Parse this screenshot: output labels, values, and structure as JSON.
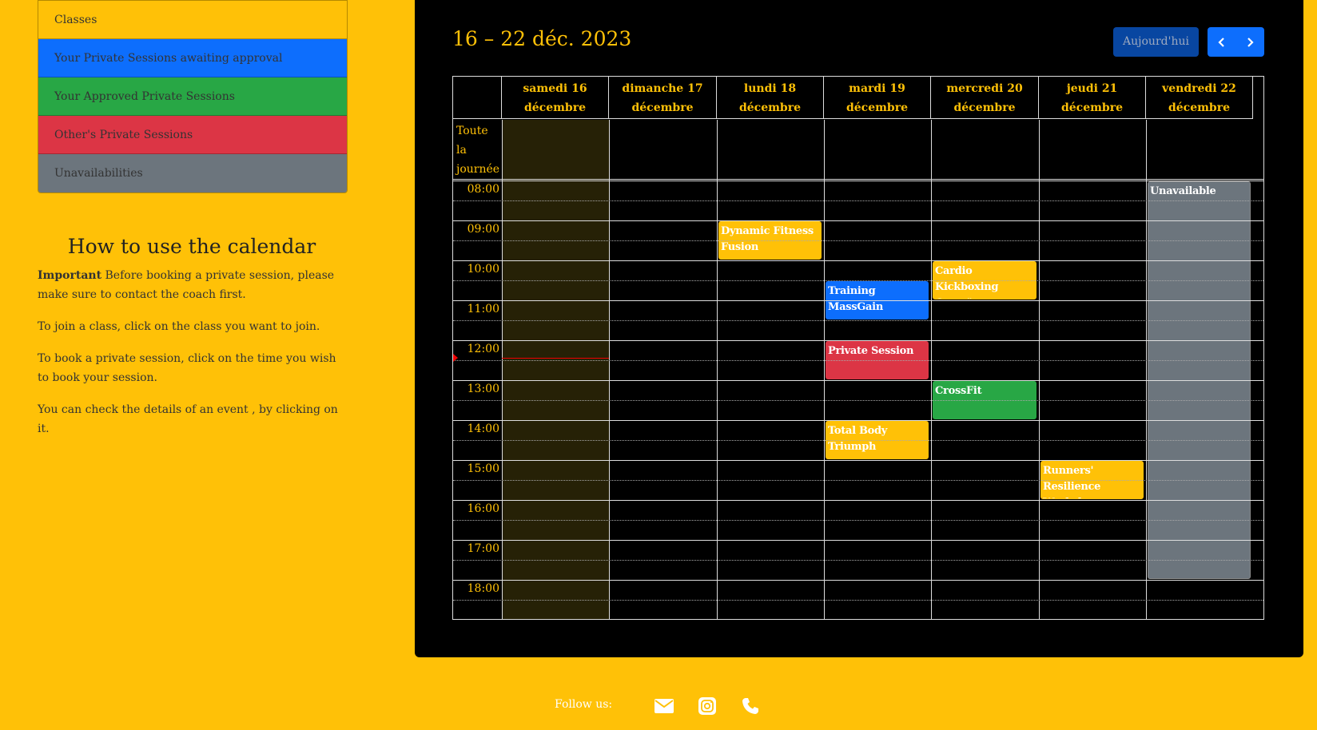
{
  "legend": {
    "items": [
      {
        "label": "Classes",
        "color": "#ffc107"
      },
      {
        "label": "Your Private Sessions awaiting approval",
        "color": "#0d6efd"
      },
      {
        "label": "Your Approved Private Sessions",
        "color": "#28a745"
      },
      {
        "label": "Other's Private Sessions",
        "color": "#dc3545"
      },
      {
        "label": "Unavailabilities",
        "color": "#6c757d"
      }
    ]
  },
  "howto": {
    "title": "How to use the calendar",
    "important_bold": "Important",
    "important_text": " Before booking a private session, please make sure to contact the coach first.",
    "p2": "To join a class, click on the class you want to join.",
    "p3": "To book a private session, click on the time you wish to book your session.",
    "p4": "You can check the details of an event , by clicking on it."
  },
  "calendar": {
    "title": "16 – 22 déc. 2023",
    "today_label": "Aujourd'hui",
    "prev_icon": "chevron-left-icon",
    "next_icon": "chevron-right-icon",
    "days": [
      "samedi 16 décembre",
      "dimanche 17 décembre",
      "lundi 18 décembre",
      "mardi 19 décembre",
      "mercredi 20 décembre",
      "jeudi 21 décembre",
      "vendredi 22 décembre"
    ],
    "all_day_label": "Toute la journée",
    "times": [
      "08:00",
      "09:00",
      "10:00",
      "11:00",
      "12:00",
      "13:00",
      "14:00",
      "15:00",
      "16:00",
      "17:00",
      "18:00"
    ],
    "events": [
      {
        "title": "Dynamic Fitness Fusion",
        "day": 2,
        "start": 9.0,
        "end": 10.0,
        "color": "#ffc107"
      },
      {
        "title": "Cardio Kickboxing Craze\"",
        "day": 4,
        "start": 10.0,
        "end": 11.0,
        "color": "#ffc107"
      },
      {
        "title": "Training MassGain",
        "day": 3,
        "start": 10.5,
        "end": 11.5,
        "color": "#0d6efd"
      },
      {
        "title": "Private Session",
        "day": 3,
        "start": 12.0,
        "end": 13.0,
        "color": "#dc3545"
      },
      {
        "title": "CrossFit",
        "day": 4,
        "start": 13.0,
        "end": 14.0,
        "color": "#28a745"
      },
      {
        "title": "Total Body Triumph",
        "day": 3,
        "start": 14.0,
        "end": 15.0,
        "color": "#ffc107"
      },
      {
        "title": "Runners' Resilience Workshop",
        "day": 5,
        "start": 15.0,
        "end": 16.0,
        "color": "#ffc107"
      },
      {
        "title": "Unavailable",
        "day": 6,
        "start": 8.0,
        "end": 18.0,
        "color": "#6c757d"
      }
    ],
    "now_time": 12.5
  },
  "footer": {
    "follow_label": "Follow us:",
    "icons": [
      "envelope-icon",
      "instagram-icon",
      "phone-icon"
    ]
  }
}
